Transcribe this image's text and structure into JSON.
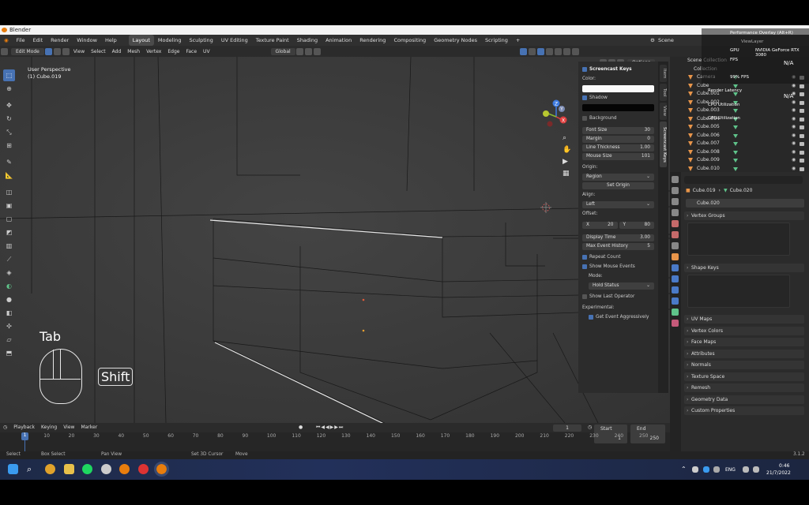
{
  "window": {
    "title": "Blender"
  },
  "menubar": {
    "menus": [
      "File",
      "Edit",
      "Render",
      "Window",
      "Help"
    ],
    "workspaces": [
      "Layout",
      "Modeling",
      "Sculpting",
      "UV Editing",
      "Texture Paint",
      "Shading",
      "Animation",
      "Rendering",
      "Compositing",
      "Geometry Nodes",
      "Scripting"
    ],
    "add_tab": "+",
    "scene": "Scene"
  },
  "viewport_header": {
    "mode": "Edit Mode",
    "menus": [
      "View",
      "Select",
      "Add",
      "Mesh",
      "Vertex",
      "Edge",
      "Face",
      "UV"
    ],
    "transform": "Global",
    "options": "Options"
  },
  "viewport": {
    "perspective": "User Perspective",
    "object": "(1) Cube.019",
    "key_tab": "Tab",
    "key_shift": "Shift",
    "gizmo": {
      "z": "Z",
      "y": "Y",
      "x": "X"
    }
  },
  "screencast_panel": {
    "header": "Screencast Keys",
    "color_label": "Color:",
    "color_value": "#ffffff",
    "shadow": "Shadow",
    "shadow_color": "#000000",
    "background": "Background",
    "fields": [
      {
        "label": "Font Size",
        "value": "30"
      },
      {
        "label": "Margin",
        "value": "0"
      },
      {
        "label": "Line Thickness",
        "value": "1.00"
      },
      {
        "label": "Mouse Size",
        "value": "101"
      }
    ],
    "origin_label": "Origin:",
    "origin_value": "Region",
    "set_origin": "Set Origin",
    "align_label": "Align:",
    "align_value": "Left",
    "offset_label": "Offset:",
    "offset_x_label": "X",
    "offset_x": "20",
    "offset_y_label": "Y",
    "offset_y": "80",
    "display_time_label": "Display Time",
    "display_time": "3.00",
    "max_history_label": "Max Event History",
    "max_history": "5",
    "repeat_count": "Repeat Count",
    "show_mouse": "Show Mouse Events",
    "mode_label": "Mode:",
    "mode_value": "Hold Status",
    "show_last_op": "Show Last Operator",
    "experimental": "Experimental:",
    "aggressive": "Get Event Aggressively"
  },
  "n_tabs": [
    "Item",
    "Tool",
    "View",
    "Screencast Keys"
  ],
  "timeline": {
    "menus": [
      "Playback",
      "Keying",
      "View",
      "Marker"
    ],
    "current": "1",
    "start_label": "Start",
    "start": "1",
    "end_label": "End",
    "end": "250",
    "ticks": [
      "1",
      "10",
      "20",
      "30",
      "40",
      "50",
      "60",
      "70",
      "80",
      "90",
      "100",
      "110",
      "120",
      "130",
      "140",
      "150",
      "160",
      "170",
      "180",
      "190",
      "200",
      "210",
      "220",
      "230",
      "240",
      "250"
    ]
  },
  "statusbar": {
    "items": [
      "Select",
      "Box Select",
      "Pan View",
      "Set 3D Cursor",
      "Move"
    ],
    "version": "3.1.2"
  },
  "outliner": {
    "scene_collection": "Scene Collection",
    "collection": "Collection",
    "items": [
      "Camera",
      "Cube",
      "Cube.001",
      "Cube.002",
      "Cube.003",
      "Cube.004",
      "Cube.005",
      "Cube.006",
      "Cube.007",
      "Cube.008",
      "Cube.009",
      "Cube.010"
    ]
  },
  "perf_overlay": {
    "title": "Performance Overlay (Alt+R)",
    "view_layer": "ViewLayer",
    "gpu": "GPU",
    "gpu_name": "NVIDIA GeForce RTX 3080",
    "fps_label": "FPS",
    "fps": "99% FPS",
    "na1": "N/A",
    "render_latency": "Render Latency",
    "na2": "N/A",
    "cpu_util": "CPU Utilization",
    "gpu_util": "GPU Utilization"
  },
  "properties": {
    "object": "Cube.019",
    "mesh": "Cube.020",
    "mesh_field": "Cube.020",
    "sections": [
      "Vertex Groups",
      "Shape Keys",
      "UV Maps",
      "Vertex Colors",
      "Face Maps",
      "Attributes",
      "Normals",
      "Texture Space",
      "Remesh",
      "Geometry Data",
      "Custom Properties"
    ]
  },
  "taskbar": {
    "lang": "ENG",
    "time": "0:46",
    "date": "21/7/2022"
  }
}
